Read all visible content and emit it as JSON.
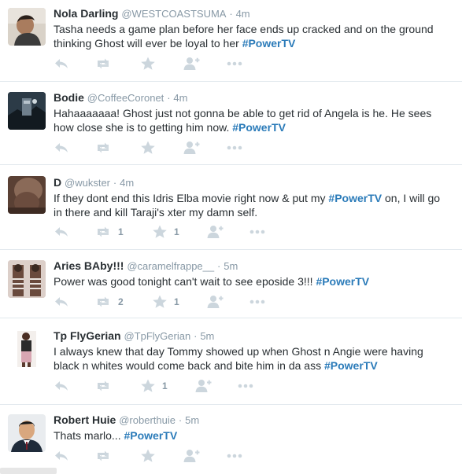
{
  "icons": {
    "reply": "reply-icon",
    "retweet": "retweet-icon",
    "favorite": "star-icon",
    "follow": "follow-icon",
    "more": "more-icon"
  },
  "colors": {
    "hashtag": "#2b7bb9",
    "meta": "#8899a6",
    "action": "#ccd6dd",
    "divider": "#e1e8ed"
  },
  "tweets": [
    {
      "name": "Nola Darling",
      "handle": "@WESTCOASTSUMA",
      "time": "4m",
      "text": "Tasha needs a game plan before her face ends up cracked and on the ground thinking Ghost will ever be loyal to her",
      "hashtag": "#PowerTV",
      "retweets": "",
      "favorites": ""
    },
    {
      "name": "Bodie",
      "handle": "@CoffeeCoronet",
      "time": "4m",
      "text": "Hahaaaaaaa! Ghost just not gonna be able to get rid of Angela is he. He sees how close she is to getting him now.",
      "hashtag": "#PowerTV",
      "retweets": "",
      "favorites": ""
    },
    {
      "name": "D",
      "handle": "@wukster",
      "time": "4m",
      "text_before": "If they dont end this Idris Elba movie right now & put my",
      "hashtag": "#PowerTV",
      "text_after": "on, I will go in there and kill Taraji's xter my damn self.",
      "retweets": "1",
      "favorites": "1"
    },
    {
      "name": "Aries BAby!!!",
      "handle": "@caramelfrappe__",
      "time": "5m",
      "text": "Power was good tonight can't wait to see eposide 3!!!",
      "hashtag": "#PowerTV",
      "retweets": "2",
      "favorites": "1"
    },
    {
      "name": "Tp FlyGerian",
      "handle": "@TpFlyGerian",
      "time": "5m",
      "text": "I always knew that day Tommy showed up when Ghost n Angie were having black n whites would come back and bite him in da ass",
      "hashtag": "#PowerTV",
      "retweets": "",
      "favorites": "1"
    },
    {
      "name": "Robert Huie",
      "handle": "@roberthuie",
      "time": "5m",
      "text": "Thats marlo...",
      "hashtag": "#PowerTV",
      "retweets": "",
      "favorites": ""
    }
  ]
}
